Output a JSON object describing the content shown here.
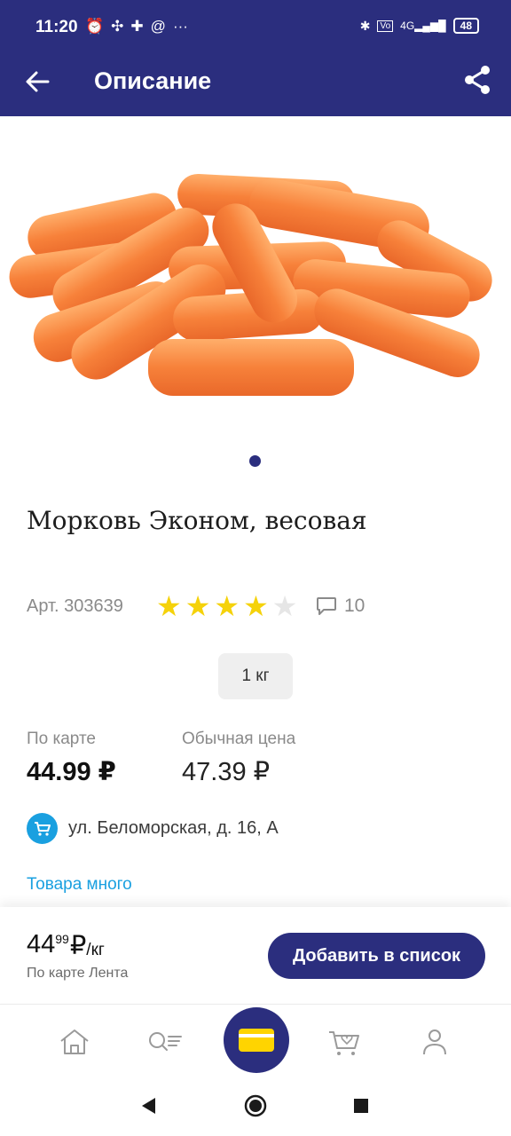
{
  "status_bar": {
    "time": "11:20",
    "left_icons": [
      "alarm-off-icon",
      "grid-icon",
      "puzzle-icon",
      "at-icon",
      "more-icon"
    ],
    "right_icons": [
      "bluetooth-icon",
      "volte-icon",
      "signal-4g-icon"
    ],
    "battery": "48"
  },
  "header": {
    "title": "Описание"
  },
  "product": {
    "name": "Морковь Эконом, весовая",
    "article": "Арт. 303639",
    "rating": 4,
    "rating_max": 5,
    "reviews_count": "10",
    "weight": "1 кг"
  },
  "prices": {
    "card_label": "По карте",
    "card_price": "44.99 ₽",
    "regular_label": "Обычная цена",
    "regular_price": "47.39 ₽"
  },
  "store": {
    "address": "ул. Беломорская, д. 16, А",
    "availability": "Товара много"
  },
  "buy_panel": {
    "price_rub": "44",
    "price_kop": "99",
    "price_currency": "₽",
    "price_unit": "/кг",
    "caption": "По карте Лента",
    "add_label": "Добавить в список"
  },
  "nav": {
    "items": [
      "home-icon",
      "catalog-search-icon",
      "loyalty-card-icon",
      "cart-icon",
      "profile-icon"
    ]
  },
  "colors": {
    "brand": "#2b2e7e",
    "accent": "#1aa0e0",
    "star": "#f5d20a",
    "star_empty": "#e6e6e6",
    "card_yellow": "#ffd400"
  }
}
